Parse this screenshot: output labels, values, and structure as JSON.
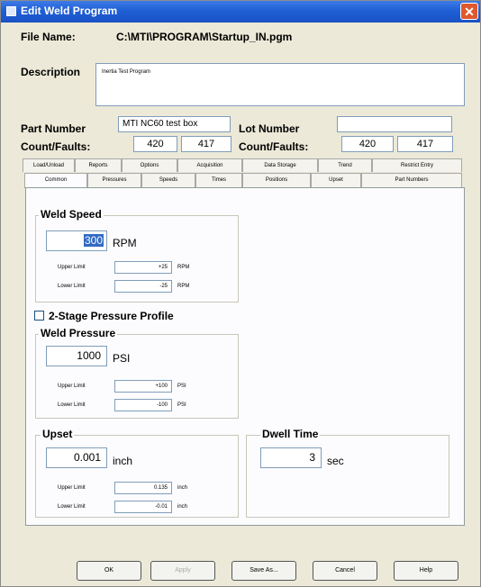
{
  "window": {
    "title": "Edit Weld Program",
    "close": "x"
  },
  "file": {
    "label": "File Name:",
    "value": "C:\\MTI\\PROGRAM\\Startup_IN.pgm"
  },
  "description": {
    "label": "Description",
    "value": "Inertia Test Program"
  },
  "part": {
    "label": "Part Number",
    "value": "MTI NC60 test box"
  },
  "lot": {
    "label": "Lot Number",
    "value": ""
  },
  "counts_left": {
    "label": "Count/Faults:",
    "count": "420",
    "faults": "417"
  },
  "counts_right": {
    "label": "Count/Faults:",
    "count": "420",
    "faults": "417"
  },
  "tabs_back": [
    "Load/Unload",
    "Reports",
    "Options",
    "Acquisition",
    "Data Storage",
    "Trend",
    "Restrict Entry"
  ],
  "tabs_front": [
    "Common",
    "Pressures",
    "Speeds",
    "Times",
    "Positions",
    "Upset",
    "Part Numbers"
  ],
  "weld_speed": {
    "title": "Weld Speed",
    "value": "300",
    "unit": "RPM",
    "upper_label": "Upper Limit",
    "upper_value": "+25",
    "upper_unit": "RPM",
    "lower_label": "Lower Limit",
    "lower_value": "-25",
    "lower_unit": "RPM"
  },
  "two_stage": {
    "label": "2-Stage Pressure Profile",
    "checked": false
  },
  "weld_pressure": {
    "title": "Weld Pressure",
    "value": "1000",
    "unit": "PSI",
    "upper_label": "Upper Limit",
    "upper_value": "+100",
    "upper_unit": "PSI",
    "lower_label": "Lower Limit",
    "lower_value": "-100",
    "lower_unit": "PSI"
  },
  "upset": {
    "title": "Upset",
    "value": "0.001",
    "unit": "inch",
    "upper_label": "Upper Limit",
    "upper_value": "0.135",
    "upper_unit": "inch",
    "lower_label": "Lower Limit",
    "lower_value": "-0.01",
    "lower_unit": "inch"
  },
  "dwell": {
    "title": "Dwell Time",
    "value": "3",
    "unit": "sec"
  },
  "buttons": {
    "ok": "OK",
    "apply": "Apply",
    "save_as": "Save As...",
    "cancel": "Cancel",
    "help": "Help"
  }
}
